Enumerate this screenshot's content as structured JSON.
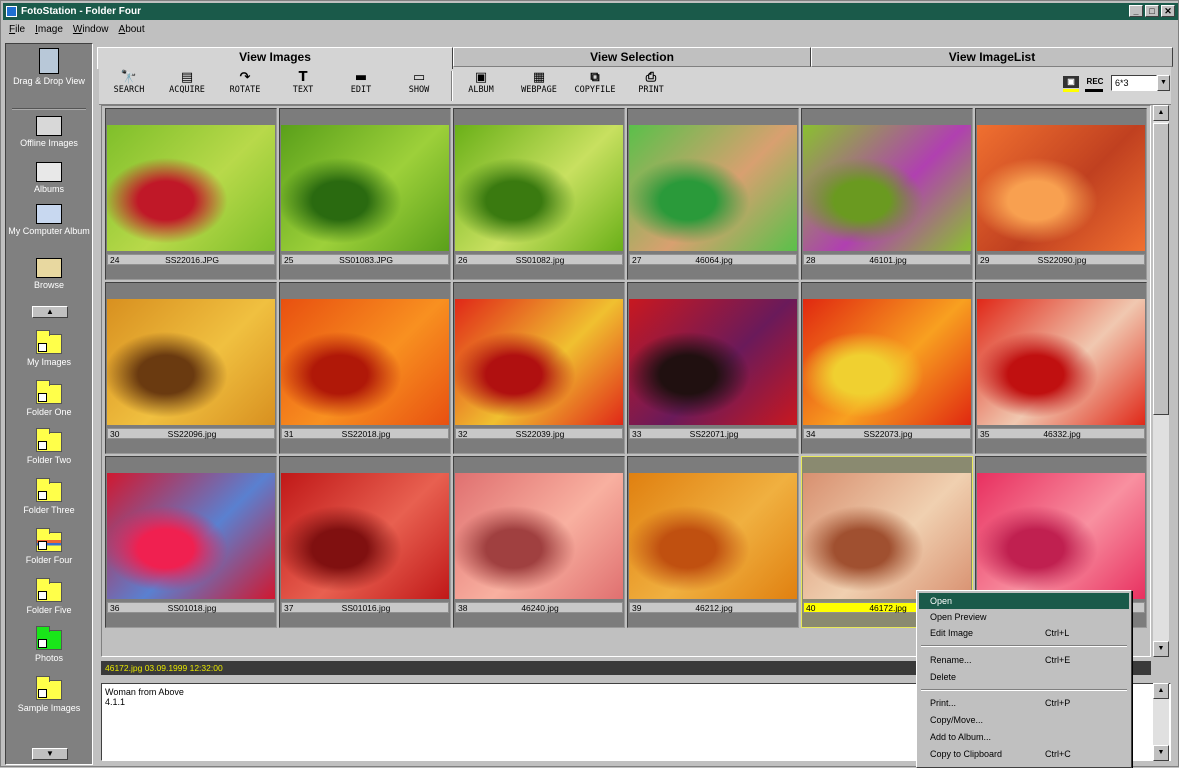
{
  "window": {
    "title": "FotoStation - Folder Four",
    "controls": [
      "_",
      "□",
      "✕"
    ]
  },
  "menubar": [
    "File",
    "Image",
    "Window",
    "About"
  ],
  "sidebar": {
    "items": [
      {
        "label": "Drag & Drop View",
        "icon": "drag-drop-icon"
      },
      {
        "label": "Offline Images",
        "icon": "offline-images-icon"
      },
      {
        "label": "Albums",
        "icon": "albums-icon"
      },
      {
        "label": "My Computer Album",
        "icon": "my-computer-album-icon"
      },
      {
        "label": "Browse",
        "icon": "browse-icon"
      }
    ],
    "folders": [
      {
        "label": "My Images"
      },
      {
        "label": "Folder One"
      },
      {
        "label": "Folder Two"
      },
      {
        "label": "Folder Three"
      },
      {
        "label": "Folder Four"
      },
      {
        "label": "Folder Five"
      },
      {
        "label": "Photos"
      },
      {
        "label": "Sample Images"
      }
    ]
  },
  "tabs": [
    {
      "label": "View Images",
      "active": true
    },
    {
      "label": "View Selection",
      "active": false
    },
    {
      "label": "View ImageList",
      "active": false
    }
  ],
  "toolbar": {
    "buttons": [
      {
        "label": "SEARCH",
        "glyph": "🔭"
      },
      {
        "label": "ACQUIRE",
        "glyph": "▤"
      },
      {
        "label": "ROTATE",
        "glyph": "↷"
      },
      {
        "label": "TEXT",
        "glyph": "T"
      },
      {
        "label": "EDIT",
        "glyph": "▬"
      },
      {
        "label": "SHOW",
        "glyph": "▭"
      },
      {
        "label": "ALBUM",
        "glyph": "▣"
      },
      {
        "label": "WEBPAGE",
        "glyph": "▦"
      },
      {
        "label": "COPYFILE",
        "glyph": "⧉"
      },
      {
        "label": "PRINT",
        "glyph": "⎙"
      }
    ],
    "view_toggle_1": "▣",
    "view_toggle_2": "REC",
    "zoom_value": "6*3",
    "zoom_dropdown": "▼"
  },
  "images": [
    {
      "num": "24",
      "name": "SS22016.JPG",
      "colors": [
        "#7fbf2a",
        "#b8d94a",
        "#c01828"
      ]
    },
    {
      "num": "25",
      "name": "SS01083.JPG",
      "colors": [
        "#5aa01a",
        "#9dd03a",
        "#2a6a10"
      ]
    },
    {
      "num": "26",
      "name": "SS01082.jpg",
      "colors": [
        "#6ab018",
        "#c8e060",
        "#3a7a10"
      ]
    },
    {
      "num": "27",
      "name": "46064.jpg",
      "colors": [
        "#5ac04a",
        "#d8a070",
        "#2a9a3a"
      ]
    },
    {
      "num": "28",
      "name": "46101.jpg",
      "colors": [
        "#8ac030",
        "#b040b0",
        "#6a9a20"
      ]
    },
    {
      "num": "29",
      "name": "SS22090.jpg",
      "colors": [
        "#f07030",
        "#c04020",
        "#f8a050"
      ]
    },
    {
      "num": "30",
      "name": "SS22096.jpg",
      "colors": [
        "#d89020",
        "#f0c040",
        "#6a3a10"
      ]
    },
    {
      "num": "31",
      "name": "SS22018.jpg",
      "colors": [
        "#e85010",
        "#f89020",
        "#b01808"
      ]
    },
    {
      "num": "32",
      "name": "SS22039.jpg",
      "colors": [
        "#e02818",
        "#f0c030",
        "#b01010"
      ]
    },
    {
      "num": "33",
      "name": "SS22071.jpg",
      "colors": [
        "#c81820",
        "#6a1a5a",
        "#201010"
      ]
    },
    {
      "num": "34",
      "name": "SS22073.jpg",
      "colors": [
        "#e02810",
        "#f8a020",
        "#f0d030"
      ]
    },
    {
      "num": "35",
      "name": "46332.jpg",
      "colors": [
        "#e02818",
        "#f0c8b0",
        "#c01010"
      ]
    },
    {
      "num": "36",
      "name": "SS01018.jpg",
      "colors": [
        "#d01830",
        "#5a80d0",
        "#f02050"
      ]
    },
    {
      "num": "37",
      "name": "SS01016.jpg",
      "colors": [
        "#c01818",
        "#e86050",
        "#801010"
      ]
    },
    {
      "num": "38",
      "name": "46240.jpg",
      "colors": [
        "#e07070",
        "#f8b0a0",
        "#a04040"
      ]
    },
    {
      "num": "39",
      "name": "46212.jpg",
      "colors": [
        "#e08010",
        "#f0b040",
        "#c05010"
      ]
    },
    {
      "num": "40",
      "name": "46172.jpg",
      "colors": [
        "#d89070",
        "#f0d0b0",
        "#a05030"
      ],
      "selected": true
    },
    {
      "num": "",
      "name": "",
      "colors": [
        "#e83060",
        "#f890a0",
        "#c02050"
      ]
    }
  ],
  "status": {
    "text": "46172.jpg    03.09.1999 12:32:00"
  },
  "info": {
    "line1": "Woman from Above",
    "line2": "4.1.1"
  },
  "context_menu": {
    "items": [
      {
        "label": "Open",
        "shortcut": "",
        "highlighted": true
      },
      {
        "label": "Open Preview",
        "shortcut": ""
      },
      {
        "label": "Edit Image",
        "shortcut": "Ctrl+L"
      },
      {
        "label": "Rename...",
        "shortcut": "Ctrl+E"
      },
      {
        "label": "Delete",
        "shortcut": ""
      },
      {
        "label": "Print...",
        "shortcut": "Ctrl+P"
      },
      {
        "label": "Copy/Move...",
        "shortcut": ""
      },
      {
        "label": "Add to Album...",
        "shortcut": ""
      },
      {
        "label": "Copy to Clipboard",
        "shortcut": "Ctrl+C"
      }
    ]
  },
  "colors": {
    "titlebar": "#1a5a4a",
    "selection": "#ffff00",
    "status_text": "#e8e800"
  }
}
